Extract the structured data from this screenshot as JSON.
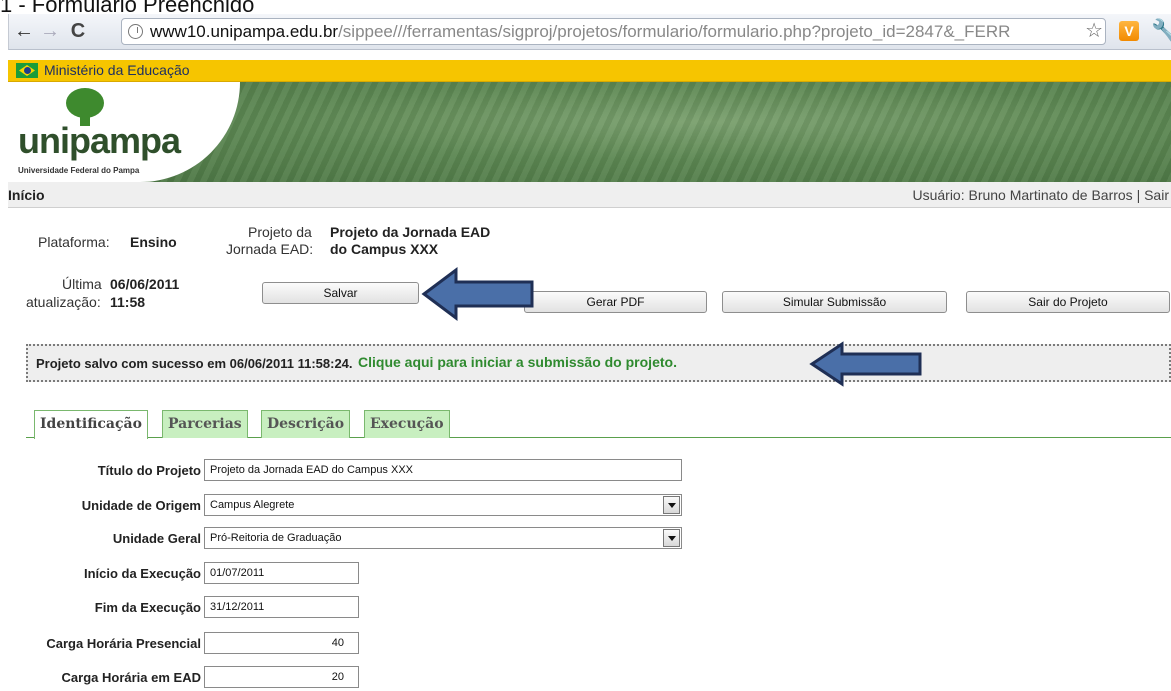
{
  "caption": "1 - Formulário Preenchido",
  "browser": {
    "url_host": "www10.unipampa.edu.br",
    "url_path": "/sippee///ferramentas/sigproj/projetos/formulario/formulario.php?projeto_id=2847&_FERR"
  },
  "gov_bar": {
    "text": "Ministério da Educação"
  },
  "logo": {
    "word": "unipampa",
    "subtitle": "Universidade Federal do Pampa"
  },
  "nav": {
    "home": "Início",
    "user_info": "Usuário: Bruno Martinato de Barros | Sair"
  },
  "project": {
    "platform_label": "Plataforma:",
    "platform_value": "Ensino",
    "project_label_1": "Projeto da",
    "project_label_2": "Jornada EAD:",
    "project_value_1": "Projeto da Jornada EAD",
    "project_value_2": "do Campus XXX",
    "updated_label_1": "Última",
    "updated_label_2": "atualização:",
    "updated_date": "06/06/2011",
    "updated_time": "11:58"
  },
  "buttons": {
    "save": "Salvar",
    "pdf": "Gerar PDF",
    "simulate": "Simular Submissão",
    "exit": "Sair do Projeto"
  },
  "status": {
    "message": "Projeto salvo com sucesso em 06/06/2011 11:58:24.",
    "submit_link": "Clique aqui para iniciar a submissão do projeto."
  },
  "tabs": [
    "Identificação",
    "Parcerias",
    "Descrição",
    "Execução"
  ],
  "form": {
    "title_label": "Título do Projeto",
    "title_value": "Projeto da Jornada EAD do Campus XXX",
    "origin_label": "Unidade de Origem",
    "origin_value": "Campus Alegrete",
    "general_label": "Unidade Geral",
    "general_value": "Pró-Reitoria de Graduação",
    "start_label": "Início da Execução",
    "start_value": "01/07/2011",
    "end_label": "Fim da Execução",
    "end_value": "31/12/2011",
    "presencial_label": "Carga Horária Presencial",
    "presencial_value": "40",
    "ead_label": "Carga Horária em EAD",
    "ead_value": "20"
  },
  "colors": {
    "gov_bar": "#f6c500",
    "banner_green": "#5c8752",
    "tab_green": "#c8efc0",
    "link_green": "#2f8a2f",
    "arrow_blue": "#4a6fa8"
  }
}
